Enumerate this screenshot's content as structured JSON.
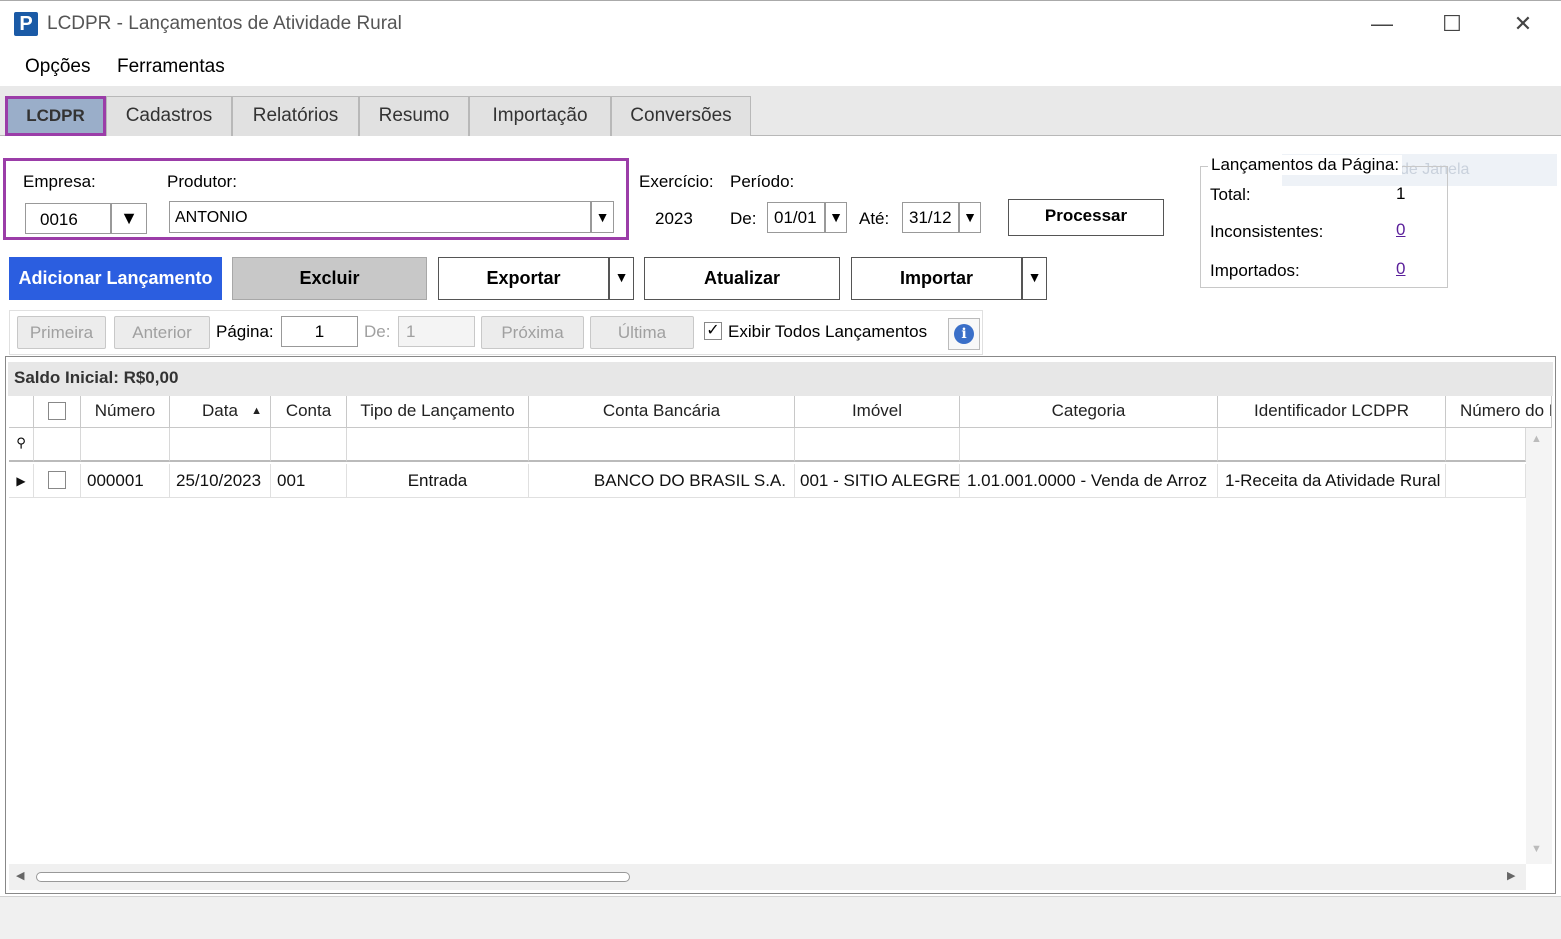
{
  "window": {
    "title": "LCDPR - Lançamentos de Atividade Rural",
    "icon_letter": "P"
  },
  "menu": [
    "Opções",
    "Ferramentas"
  ],
  "tabs": [
    "LCDPR",
    "Cadastros",
    "Relatórios",
    "Resumo",
    "Importação",
    "Conversões"
  ],
  "filters": {
    "empresa_label": "Empresa:",
    "empresa_value": "0016",
    "produtor_label": "Produtor:",
    "produtor_value": "ANTONIO",
    "exercicio_label": "Exercício:",
    "exercicio_value": "2023",
    "periodo_label": "Período:",
    "de_label": "De:",
    "de_value": "01/01",
    "ate_label": "Até:",
    "ate_value": "31/12",
    "processar_label": "Processar"
  },
  "page_summary": {
    "title": "Lançamentos da Página:",
    "total_label": "Total:",
    "total_value": "1",
    "inconsistentes_label": "Inconsistentes:",
    "inconsistentes_value": "0",
    "importados_label": "Importados:",
    "importados_value": "0",
    "ghost_text": "de Janela"
  },
  "actions": {
    "adicionar": "Adicionar Lançamento",
    "excluir": "Excluir",
    "exportar": "Exportar",
    "atualizar": "Atualizar",
    "importar": "Importar"
  },
  "pagination": {
    "primeira": "Primeira",
    "anterior": "Anterior",
    "pagina_label": "Página:",
    "pagina_value": "1",
    "de_label": "De:",
    "de_value": "1",
    "proxima": "Próxima",
    "ultima": "Última",
    "exibir_todos": "Exibir Todos Lançamentos",
    "exibir_todos_checked": true
  },
  "grid": {
    "caption": "Saldo Inicial: R$0,00",
    "columns": [
      "Número",
      "Data",
      "Conta",
      "Tipo de Lançamento",
      "Conta Bancária",
      "Imóvel",
      "Categoria",
      "Identificador LCDPR",
      "Número do D"
    ],
    "rows": [
      {
        "numero": "000001",
        "data": "25/10/2023",
        "conta": "001",
        "tipo": "Entrada",
        "conta_bancaria": "BANCO DO BRASIL S.A.",
        "imovel": "001 - SITIO ALEGRE",
        "categoria": "1.01.001.0000 - Venda de Arroz",
        "identificador": "1-Receita da Atividade Rural",
        "numero_doc": ""
      }
    ]
  },
  "colors": {
    "accent_purple": "#9b3da8",
    "primary_blue": "#2b5ee0",
    "active_tab": "#9aaec9",
    "link": "#5a1f9a"
  }
}
